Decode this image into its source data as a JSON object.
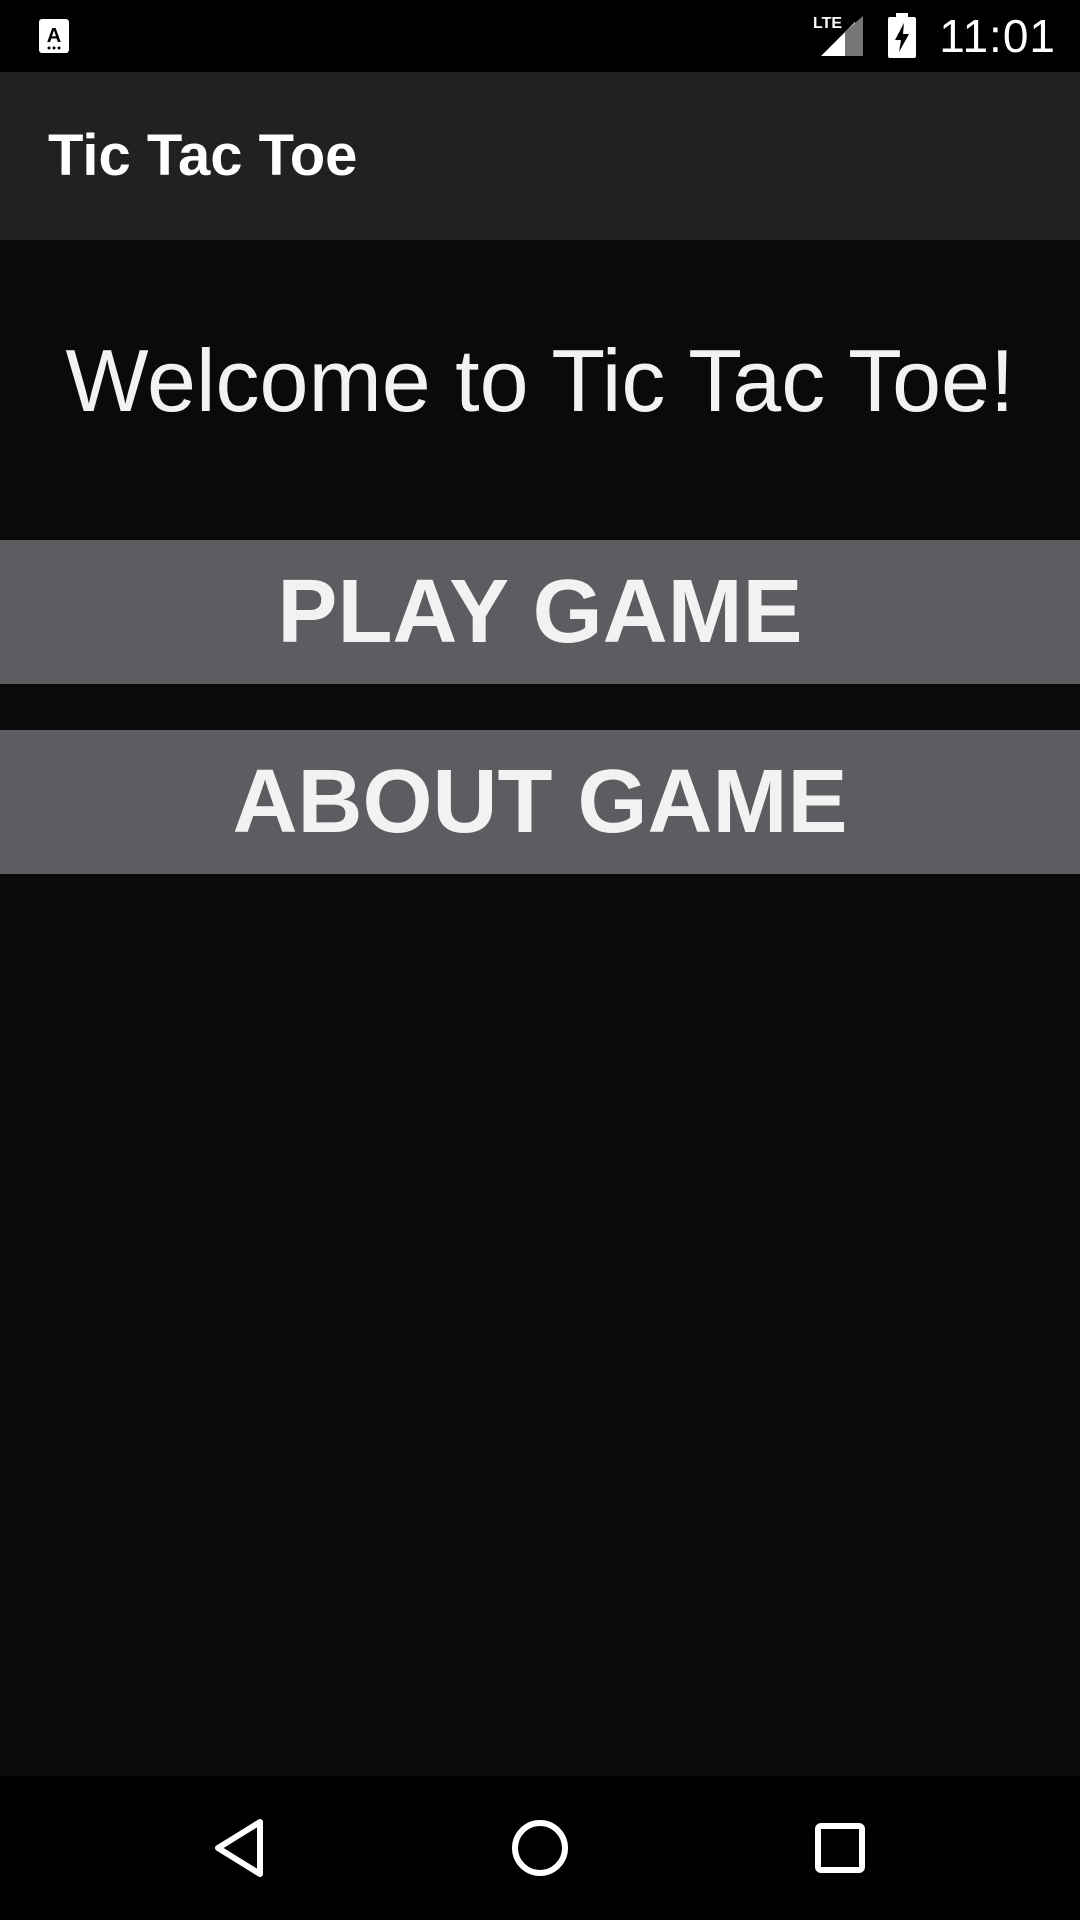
{
  "status_bar": {
    "left_icon": "keyboard-a-icon",
    "network_label": "LTE",
    "signal_icon": "signal-icon",
    "battery_icon": "battery-charging-icon",
    "time": "11:01"
  },
  "app_bar": {
    "title": "Tic Tac Toe"
  },
  "main": {
    "welcome_text": "Welcome to Tic Tac Toe!",
    "play_button_label": "PLAY GAME",
    "about_button_label": "ABOUT GAME"
  },
  "nav_bar": {
    "back_icon": "back-icon",
    "home_icon": "home-icon",
    "recents_icon": "recents-icon"
  },
  "colors": {
    "background": "#0a0a0a",
    "app_bar": "#212121",
    "button": "#5c5d60",
    "text": "#f2f2f2"
  }
}
